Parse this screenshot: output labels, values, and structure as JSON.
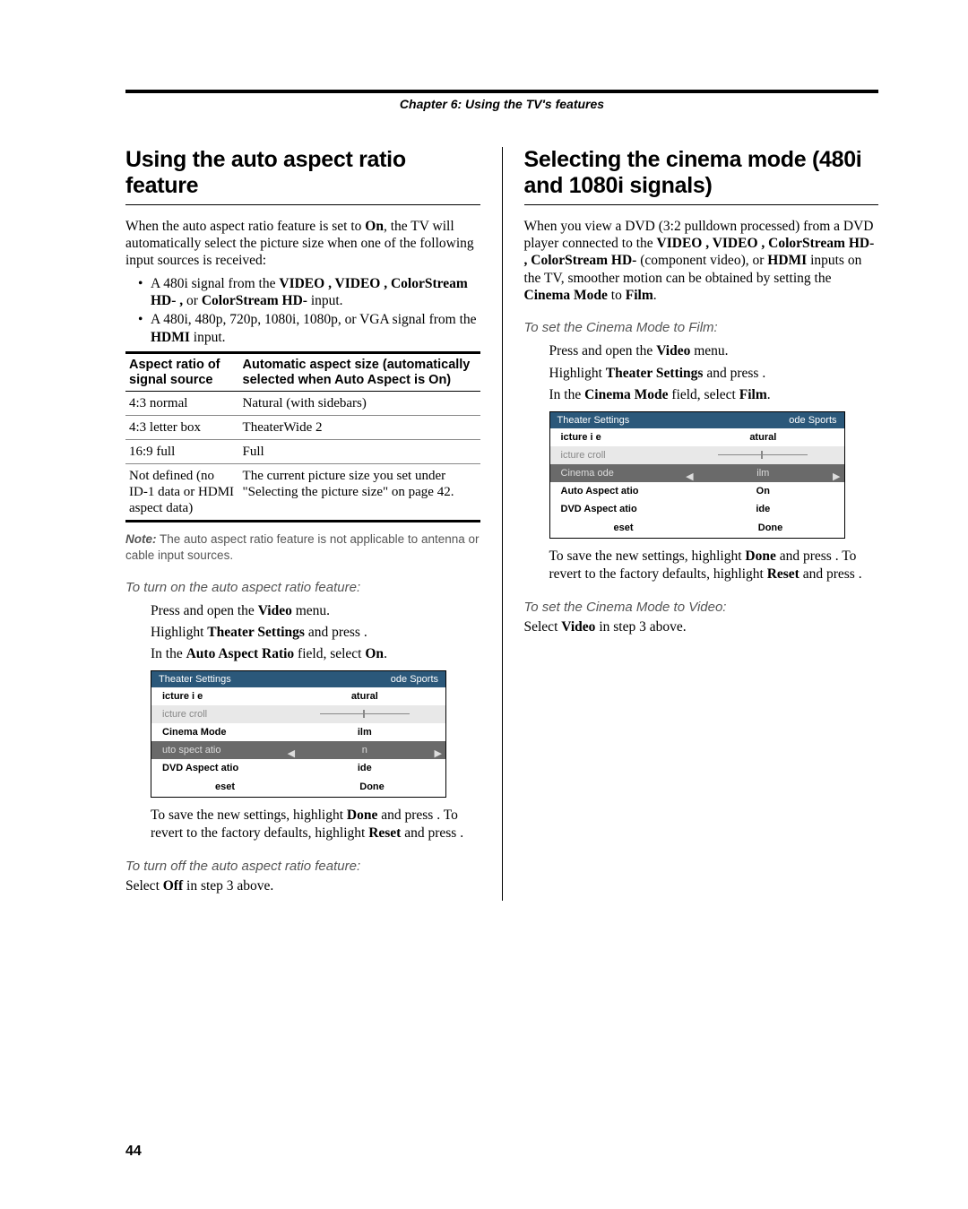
{
  "chapter_title": "Chapter 6: Using the TV's features",
  "page_number": "44",
  "left": {
    "heading": "Using the auto aspect ratio feature",
    "intro_pre": "When the auto aspect ratio feature is set to ",
    "intro_on": "On",
    "intro_post": ", the TV will automatically select the picture size when one of the following input sources is received:",
    "bullet1_pre": "A 480i signal from the ",
    "bullet1_items": "VIDEO , VIDEO , ColorStream HD- , ",
    "bullet1_or": "or ",
    "bullet1_cs": "ColorStream HD-",
    "bullet1_end": " input.",
    "bullet2_pre": "A 480i, 480p, 720p, 1080i, 1080p, or VGA signal from the ",
    "bullet2_hdmi": "HDMI",
    "bullet2_end": " input.",
    "table": {
      "h1": "Aspect ratio of signal source",
      "h2": "Automatic aspect size (automatically selected when Auto Aspect is On)",
      "rows": [
        {
          "a": "4:3 normal",
          "b": "Natural (with sidebars)"
        },
        {
          "a": "4:3 letter box",
          "b": "TheaterWide 2"
        },
        {
          "a": "16:9 full",
          "b": "Full"
        },
        {
          "a": "Not defined (no ID-1 data or HDMI aspect data)",
          "b": "The current picture size you set under \"Selecting the picture size\" on page 42."
        }
      ]
    },
    "note_label": "Note:",
    "note_text": " The auto aspect ratio feature is not applicable to antenna or cable input sources.",
    "sub_on": "To turn on the auto aspect ratio feature:",
    "step1_pre": "Press ",
    "step1_mid": " and open the ",
    "step1_video": "Video",
    "step1_end": " menu.",
    "step2_pre": "Highlight ",
    "step2_ts": "Theater Settings",
    "step2_mid": " and press ",
    "step2_end": ".",
    "step3_pre": "In the ",
    "step3_aar": "Auto Aspect Ratio",
    "step3_mid": " field, select ",
    "step3_on": "On",
    "step3_end": ".",
    "save_pre": "To save the new settings, highlight ",
    "save_done": "Done",
    "save_mid": " and press ",
    "save_end": ". To revert to the factory defaults, highlight ",
    "save_reset": "Reset",
    "save_end2": " and press .",
    "sub_off": "To turn off the auto aspect ratio feature:",
    "off_pre": "Select ",
    "off_off": "Off",
    "off_end": " in step 3 above.",
    "osd": {
      "title_l": "Theater Settings",
      "title_r": "ode Sports",
      "r1_l": "icture i e",
      "r1_v": "atural",
      "r2_l": "icture croll",
      "r3_l": "Cinema Mode",
      "r3_v": "ilm",
      "r4_l": "uto spect atio",
      "r4_v": "n",
      "r5_l": "DVD Aspect atio",
      "r5_v": "ide",
      "f_l": "eset",
      "f_r": "Done"
    }
  },
  "right": {
    "heading": "Selecting the cinema mode (480i and 1080i signals)",
    "intro_pre": "When you view a DVD (3:2 pulldown processed) from a DVD player connected to the ",
    "intro_items": "VIDEO , VIDEO , ColorStream HD- , ColorStream HD-",
    "intro_comp": " (component video), or ",
    "intro_hdmi": "HDMI",
    "intro_mid": " inputs on the TV, smoother motion can be obtained by setting the ",
    "intro_cm": "Cinema Mode",
    "intro_to": " to ",
    "intro_film": "Film",
    "intro_end": ".",
    "sub_film": "To set the Cinema Mode to Film:",
    "step1_pre": "Press ",
    "step1_mid": " and open the ",
    "step1_video": "Video",
    "step1_end": " menu.",
    "step2_pre": "Highlight ",
    "step2_ts": "Theater Settings",
    "step2_mid": " and press ",
    "step2_end": ".",
    "step3_pre": "In the ",
    "step3_cm": "Cinema Mode",
    "step3_mid": " field, select ",
    "step3_film": "Film",
    "step3_end": ".",
    "save_pre": "To save the new settings, highlight ",
    "save_done": "Done",
    "save_mid": " and press ",
    "save_end": ". To revert to the factory defaults, highlight ",
    "save_reset": "Reset",
    "save_end2": " and press .",
    "sub_video": "To set the Cinema Mode to Video:",
    "vid_pre": "Select ",
    "vid_video": "Video",
    "vid_end": " in step 3 above.",
    "osd": {
      "title_l": "Theater Settings",
      "title_r": "ode Sports",
      "r1_l": "icture i e",
      "r1_v": "atural",
      "r2_l": "icture croll",
      "r3_l": "Cinema ode",
      "r3_v": "ilm",
      "r4_l": "Auto Aspect atio",
      "r4_v": "On",
      "r5_l": "DVD Aspect atio",
      "r5_v": "ide",
      "f_l": "eset",
      "f_r": "Done"
    }
  }
}
